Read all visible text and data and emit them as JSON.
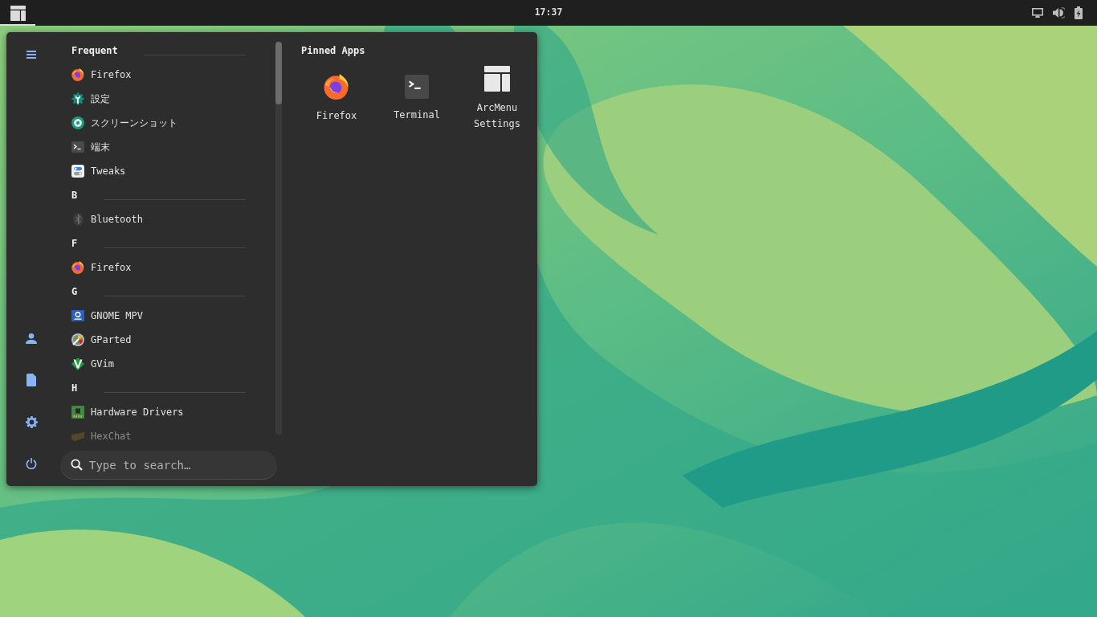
{
  "top_bar": {
    "menu_button": {
      "active": true
    },
    "clock": "17:37"
  },
  "menu": {
    "sections": [
      {
        "title": "Frequent",
        "items": [
          {
            "name": "Firefox"
          },
          {
            "name": "設定"
          },
          {
            "name": "スクリーンショット"
          },
          {
            "name": "端末"
          },
          {
            "name": "Tweaks"
          }
        ]
      },
      {
        "title": "B",
        "items": [
          {
            "name": "Bluetooth"
          }
        ]
      },
      {
        "title": "F",
        "items": [
          {
            "name": "Firefox"
          }
        ]
      },
      {
        "title": "G",
        "items": [
          {
            "name": "GNOME MPV"
          },
          {
            "name": "GParted"
          },
          {
            "name": "GVim"
          }
        ]
      },
      {
        "title": "H",
        "items": [
          {
            "name": "Hardware Drivers"
          },
          {
            "name": "HexChat"
          }
        ]
      }
    ],
    "pinned": {
      "title": "Pinned Apps",
      "items": [
        {
          "name": "Firefox"
        },
        {
          "name": "Terminal"
        },
        {
          "name": "ArcMenu Settings"
        }
      ]
    },
    "search": {
      "placeholder": "Type to search…"
    }
  }
}
